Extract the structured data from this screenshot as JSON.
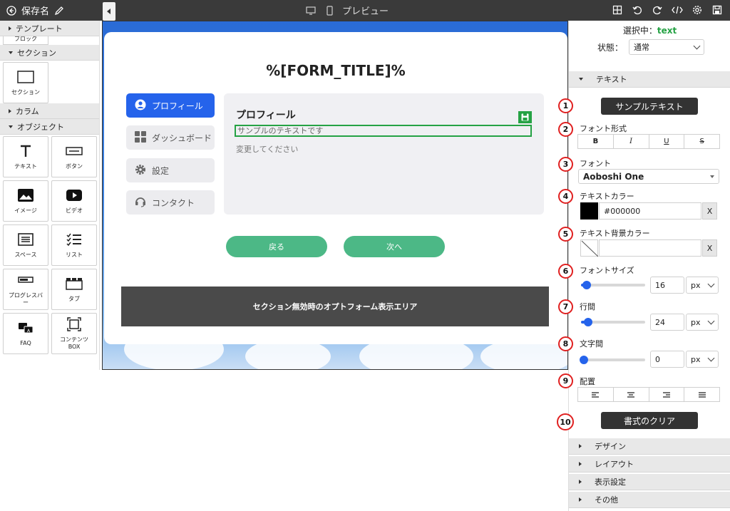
{
  "topbar": {
    "save_name": "保存名",
    "preview_label": "プレビュー"
  },
  "left_panel": {
    "template_header": "テンプレート",
    "template_partial_label": "ブロック",
    "section_header": "セクション",
    "section_tile": "セクション",
    "column_header": "カラム",
    "object_header": "オブジェクト",
    "objects": [
      {
        "label": "テキスト",
        "icon": "text-icon"
      },
      {
        "label": "ボタン",
        "icon": "button-icon"
      },
      {
        "label": "イメージ",
        "icon": "image-icon"
      },
      {
        "label": "ビデオ",
        "icon": "video-icon"
      },
      {
        "label": "スペース",
        "icon": "space-icon"
      },
      {
        "label": "リスト",
        "icon": "list-icon"
      },
      {
        "label": "プログレスバー",
        "icon": "progressbar-icon"
      },
      {
        "label": "タブ",
        "icon": "tab-icon"
      },
      {
        "label": "FAQ",
        "icon": "faq-icon"
      },
      {
        "label": "コンテンツBOX",
        "icon": "content-box-icon"
      }
    ]
  },
  "canvas": {
    "form_title": "%[FORM_TITLE]%",
    "nav": [
      {
        "label": "プロフィール",
        "icon": "user-icon",
        "active": true
      },
      {
        "label": "ダッシュボード",
        "icon": "dashboard-icon",
        "active": false
      },
      {
        "label": "設定",
        "icon": "gear-icon",
        "active": false
      },
      {
        "label": "コンタクト",
        "icon": "headset-icon",
        "active": false
      }
    ],
    "content_title": "プロフィール",
    "sample_text": "サンプルのテキストです",
    "sub_text": "変更してください",
    "back_button": "戻る",
    "next_button": "次へ",
    "optout_text": "セクション無効時のオプトフォーム表示エリア"
  },
  "right_panel": {
    "selected_label": "選択中：",
    "selected_value": "text",
    "state_label": "状態：",
    "state_value": "通常",
    "text_section": "テキスト",
    "sample_button": "サンプルテキスト",
    "font_style_label": "フォント形式",
    "font_style_buttons": [
      "B",
      "I",
      "U",
      "S"
    ],
    "font_label": "フォント",
    "font_value": "Aoboshi One",
    "text_color_label": "テキストカラー",
    "text_color_value": "#000000",
    "text_bg_color_label": "テキスト背景カラー",
    "clear_x": "X",
    "font_size_label": "フォントサイズ",
    "font_size_value": "16",
    "line_height_label": "行間",
    "line_height_value": "24",
    "letter_spacing_label": "文字間",
    "letter_spacing_value": "0",
    "unit_value": "px",
    "align_label": "配置",
    "clear_format_button": "書式のクリア",
    "sections": [
      "デザイン",
      "レイアウト",
      "表示設定",
      "その他"
    ],
    "markers": [
      "1",
      "2",
      "3",
      "4",
      "5",
      "6",
      "7",
      "8",
      "9",
      "10"
    ]
  },
  "colors": {
    "accent_blue": "#2563eb",
    "accent_green": "#25a244",
    "pill_green": "#4cb886",
    "marker_red": "#e02020",
    "dark": "#333333"
  }
}
